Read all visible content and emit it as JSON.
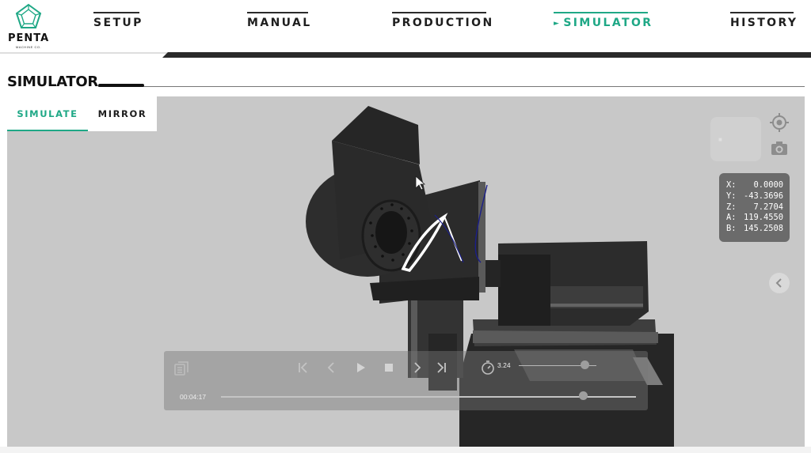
{
  "logo": {
    "brand": "PENTA",
    "sub": "MACHINE CO."
  },
  "nav": {
    "setup": "SETUP",
    "manual": "MANUAL",
    "production": "PRODUCTION",
    "simulator": "SIMULATOR",
    "history": "HISTORY",
    "active": "SIMULATOR"
  },
  "page": {
    "title": "SIMULATOR"
  },
  "tabs": {
    "simulate": "SIMULATE",
    "mirror": "MIRROR",
    "active": "SIMULATE"
  },
  "coords": {
    "x_label": "X:",
    "x": "0.0000",
    "y_label": "Y:",
    "y": "-43.3696",
    "z_label": "Z:",
    "z": "7.2704",
    "a_label": "A:",
    "a": "119.4550",
    "b_label": "B:",
    "b": "145.2508"
  },
  "player": {
    "speed": "3.24",
    "time": "00:04:17",
    "speed_level_fraction": 0.8,
    "progress_fraction": 0.87
  },
  "icons": {
    "right_top": "crosshair-icon",
    "right_camera": "camera-icon",
    "collapse": "chevron-left-icon",
    "list": "list-icon",
    "skip_start": "skip-start-icon",
    "step_back": "step-back-icon",
    "play": "play-icon",
    "stop": "stop-icon",
    "step_forward": "step-forward-icon",
    "skip_end": "skip-end-icon",
    "speed": "stopwatch-icon"
  },
  "colors": {
    "accent": "#1fa886",
    "viewport_bg": "#c8c8c8",
    "coords_bg": "#6b6b6b"
  }
}
